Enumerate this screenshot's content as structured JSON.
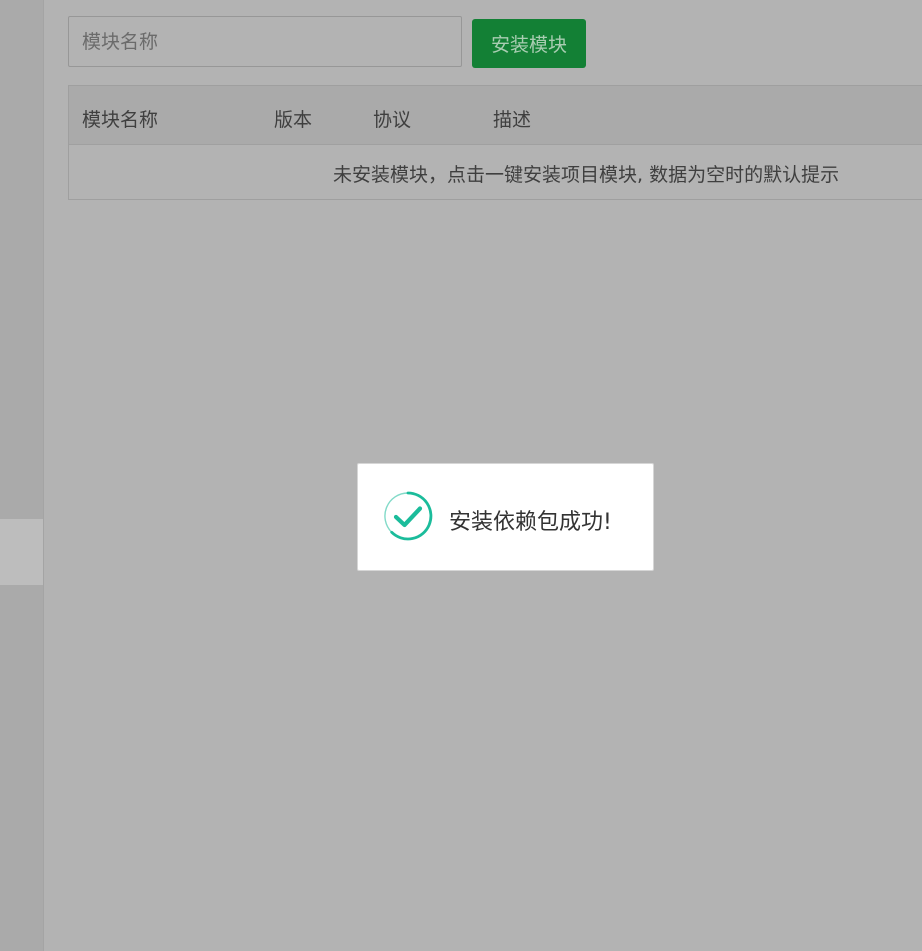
{
  "search": {
    "placeholder": "模块名称",
    "value": ""
  },
  "toolbar": {
    "install_label": "安装模块"
  },
  "table": {
    "columns": [
      "模块名称",
      "版本",
      "协议",
      "描述"
    ],
    "empty_text": "未安装模块，点击一键安装项目模块, 数据为空时的默认提示"
  },
  "toast": {
    "icon": "check-circle-icon",
    "message": "安装依赖包成功!",
    "color": "#1bbc9b"
  },
  "colors": {
    "primary_button": "#138035",
    "overlay": "#b3b3b3"
  }
}
